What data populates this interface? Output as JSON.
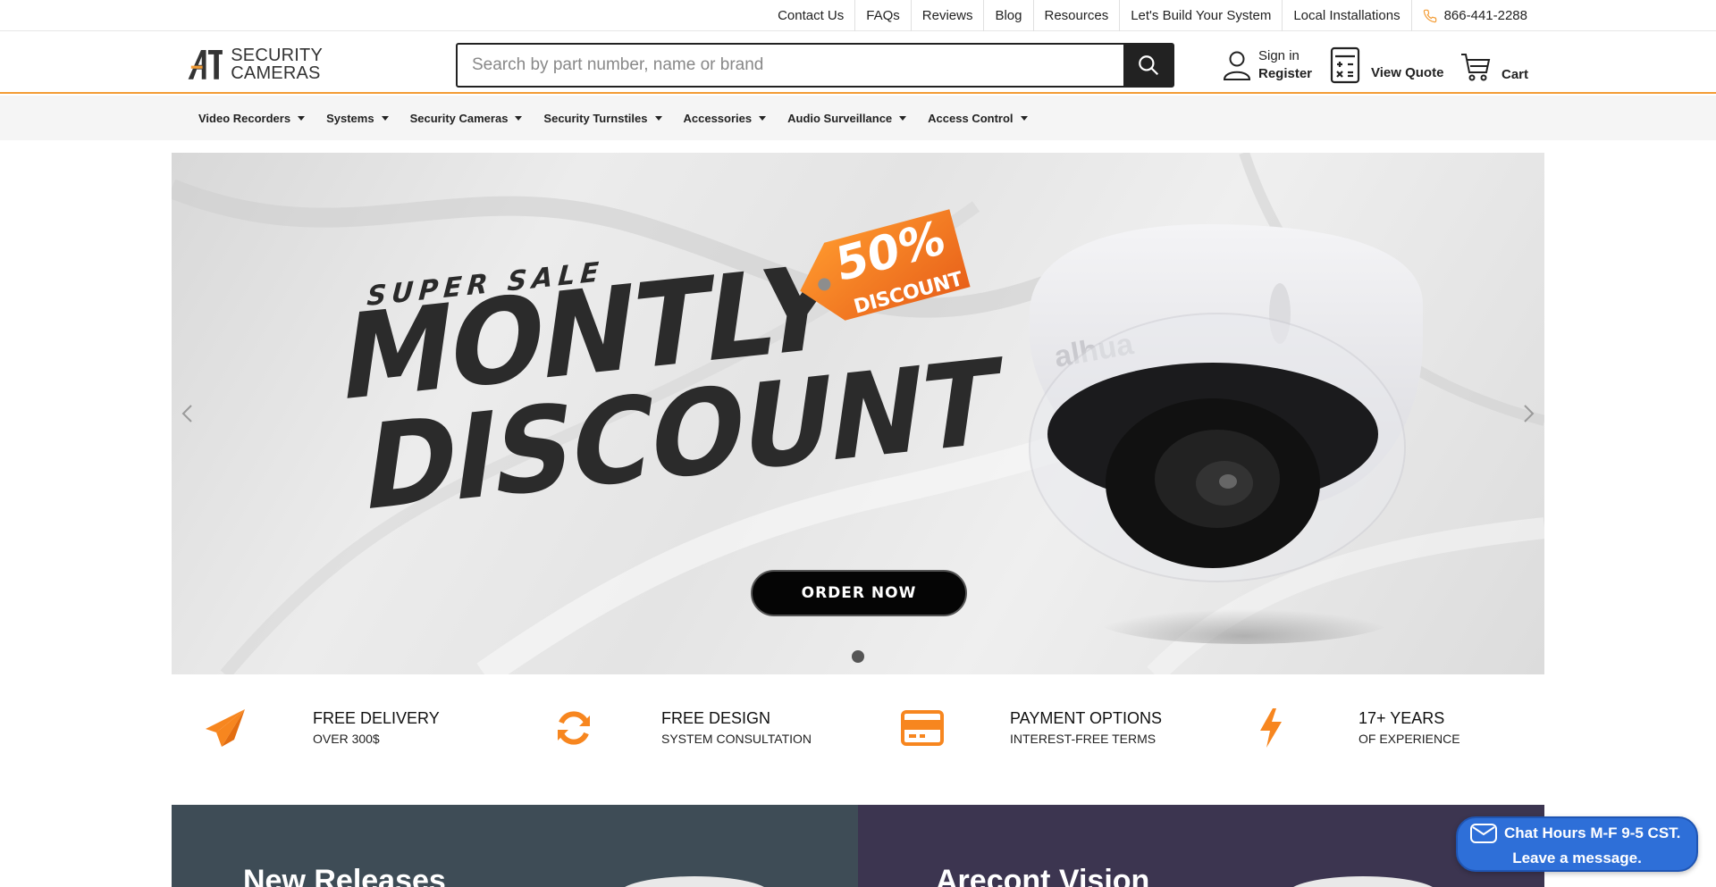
{
  "top_nav": {
    "links": [
      "Contact Us",
      "FAQs",
      "Reviews",
      "Blog",
      "Resources",
      "Let's Build Your System",
      "Local Installations"
    ],
    "phone": "866-441-2288"
  },
  "header": {
    "logo": {
      "mark": "A1",
      "line1": "SECURITY",
      "line2": "CAMERAS"
    },
    "search_placeholder": "Search by part number, name or brand",
    "account": {
      "sign_in": "Sign in",
      "register": "Register"
    },
    "quote_label": "View Quote",
    "cart_label": "Cart"
  },
  "categories": [
    "Video Recorders",
    "Systems",
    "Security Cameras",
    "Security Turnstiles",
    "Accessories",
    "Audio Surveillance",
    "Access Control"
  ],
  "hero": {
    "super_sale": "SUPER SALE",
    "headline_1": "MONTLY",
    "headline_2": "DISCOUNT",
    "tag_percent": "50%",
    "tag_word": "DISCOUNT",
    "camera_brand": "alhua",
    "cta": "ORDER NOW"
  },
  "features": [
    {
      "title": "FREE DELIVERY",
      "subtitle": "OVER 300$",
      "icon": "paper-plane-icon"
    },
    {
      "title": "FREE DESIGN",
      "subtitle": "SYSTEM CONSULTATION",
      "icon": "refresh-icon"
    },
    {
      "title": "PAYMENT OPTIONS",
      "subtitle": "INTEREST-FREE TERMS",
      "icon": "credit-card-icon"
    },
    {
      "title": "17+ YEARS",
      "subtitle": "OF EXPERIENCE",
      "icon": "lightning-icon"
    }
  ],
  "promos": [
    {
      "title": "New Releases"
    },
    {
      "title": "Arecont Vision"
    }
  ],
  "chat": {
    "line1": "Chat Hours M-F 9-5 CST.",
    "line2": "Leave a message."
  },
  "colors": {
    "accent": "#f39c35",
    "feature_icon": "#f7861f",
    "promo_left": "#3e4c56",
    "promo_right": "#3c3550",
    "chat": "#2e6fd8"
  }
}
